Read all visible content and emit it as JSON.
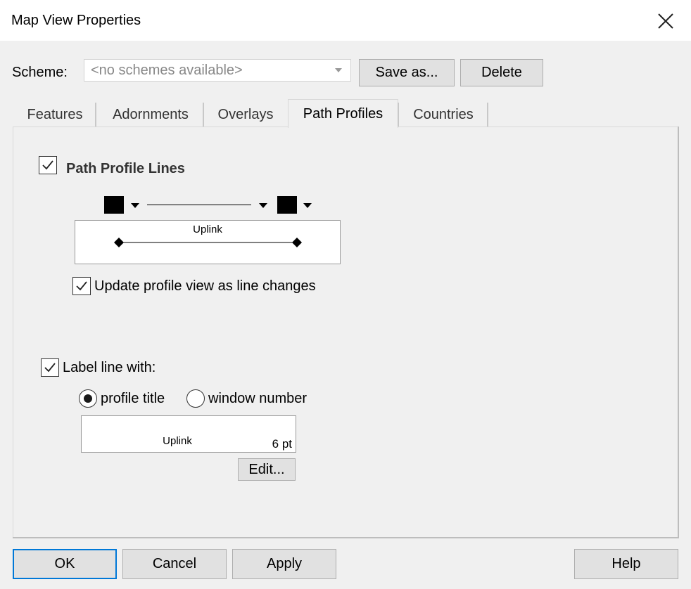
{
  "window": {
    "title": "Map View Properties"
  },
  "scheme": {
    "label": "Scheme:",
    "value": "<no schemes available>",
    "save_as_label": "Save as...",
    "delete_label": "Delete"
  },
  "tabs": [
    {
      "label": "Features",
      "active": false
    },
    {
      "label": "Adornments",
      "active": false
    },
    {
      "label": "Overlays",
      "active": false
    },
    {
      "label": "Path Profiles",
      "active": true
    },
    {
      "label": "Countries",
      "active": false
    }
  ],
  "path_profile": {
    "lines_label": "Path Profile Lines",
    "lines_checked": true,
    "start_marker_color": "#000000",
    "end_marker_color": "#000000",
    "preview_text": "Uplink",
    "update_label": "Update profile view as line changes",
    "update_checked": true,
    "label_line_label": "Label line with:",
    "label_line_checked": true,
    "option_profile_title": "profile title",
    "option_window_number": "window number",
    "selected_option": "profile title",
    "label_preview_text": "Uplink",
    "label_font_size": "6 pt",
    "edit_label": "Edit..."
  },
  "footer": {
    "ok_label": "OK",
    "cancel_label": "Cancel",
    "apply_label": "Apply",
    "help_label": "Help"
  },
  "colors": {
    "accent": "#0078d7",
    "button_bg": "#e1e1e1",
    "dialog_bg": "#f0f0f0"
  }
}
